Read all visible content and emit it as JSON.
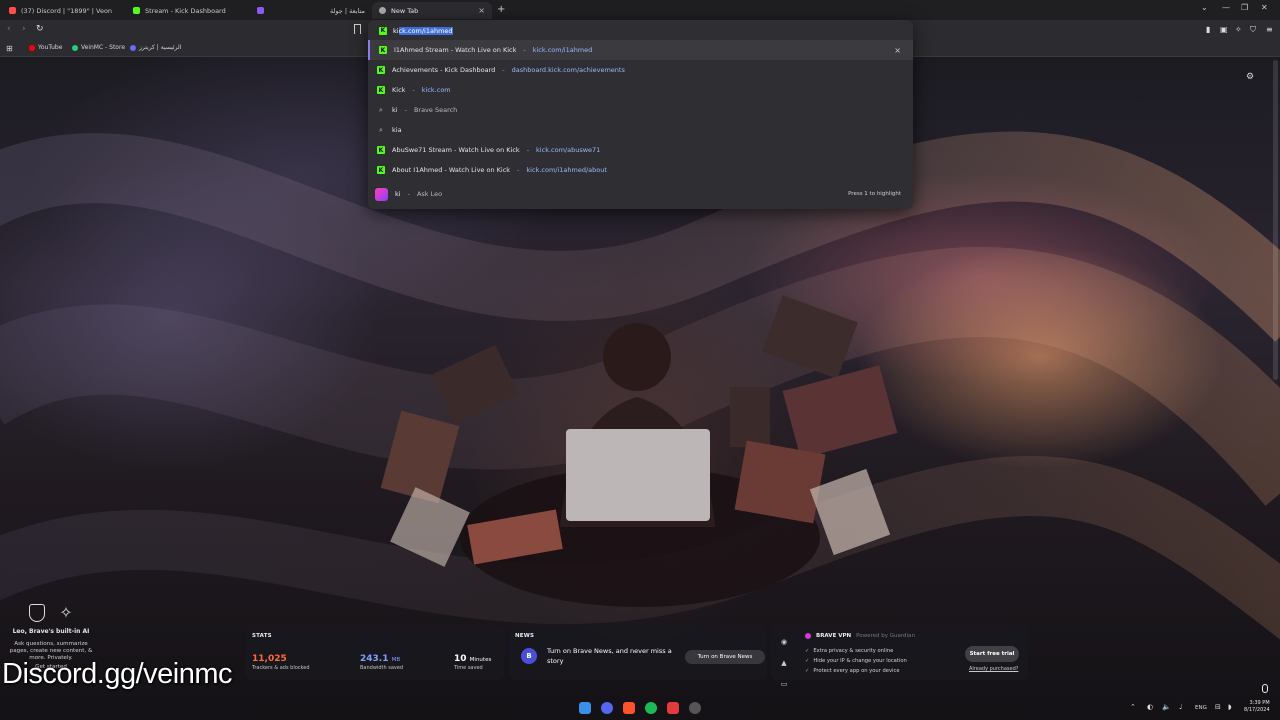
{
  "tabs": [
    {
      "title": "(37) Discord | \"1899\" | Veon",
      "color": "#ff4d4d"
    },
    {
      "title": "Stream - Kick Dashboard",
      "color": "#53fc18"
    },
    {
      "title": "",
      "color": "#8a5cf6"
    },
    {
      "title": "متابعة | جولة",
      "color": "#999999"
    },
    {
      "title": "New Tab",
      "color": "#aaaaaa"
    }
  ],
  "bookmarks": [
    {
      "label": "YouTube",
      "color": "#ff0000"
    },
    {
      "label": "VeinMC - Store",
      "color": "#1fd17b"
    },
    {
      "label": "الرئيسية | كريترز",
      "color": "#6b6bff"
    }
  ],
  "omnibox": {
    "typed": "ki",
    "autocomplete": "ck.com/i1ahmed",
    "suggestions": [
      {
        "kind": "kick",
        "title": "I1Ahmed Stream - Watch Live on Kick",
        "url": "kick.com/i1ahmed",
        "removable": true
      },
      {
        "kind": "kick",
        "title": "Achievements - Kick Dashboard",
        "url": "dashboard.kick.com/achievements"
      },
      {
        "kind": "kick",
        "title": "Kick",
        "url": "kick.com"
      },
      {
        "kind": "search",
        "title": "ki",
        "muted": "Brave Search"
      },
      {
        "kind": "search",
        "title": "kia",
        "muted": ""
      },
      {
        "kind": "kick",
        "title": "AbuSwe71 Stream - Watch Live on Kick",
        "url": "kick.com/abuswe71"
      },
      {
        "kind": "kick",
        "title": "About I1Ahmed - Watch Live on Kick",
        "url": "kick.com/i1ahmed/about"
      }
    ],
    "leo": {
      "title": "ki",
      "muted": "Ask Leo",
      "hint": "Press 1 to highlight"
    }
  },
  "leo_promo": {
    "heading": "Leo, Brave's built-in AI",
    "body": "Ask questions, summarize pages, create new content, & more. Privately.",
    "cta": "Get started"
  },
  "watermark": "Discord.gg/veinmc",
  "stats": {
    "title": "STATS",
    "items": [
      {
        "value": "11,025",
        "unit": "",
        "label": "Trackers & ads blocked",
        "color": "#ff6a3d"
      },
      {
        "value": "243.1",
        "unit": "MB",
        "label": "Bandwidth saved",
        "color": "#7fa2ff"
      },
      {
        "value": "10",
        "unit": "Minutes",
        "label": "Time saved",
        "color": "#ffffff"
      }
    ]
  },
  "news": {
    "title": "NEWS",
    "text": "Turn on Brave News, and never miss a story",
    "button": "Turn on Brave News"
  },
  "vpn": {
    "title": "BRAVE VPN",
    "powered": "Powered by Guardian",
    "features": [
      "Extra privacy & security online",
      "Hide your IP & change your location",
      "Protect every app on your device"
    ],
    "button": "Start free trial",
    "link": "Already purchased?"
  },
  "clock": {
    "time": "3:39 PM",
    "date": "8/17/2024"
  },
  "tray": {
    "lang": "ENG"
  }
}
